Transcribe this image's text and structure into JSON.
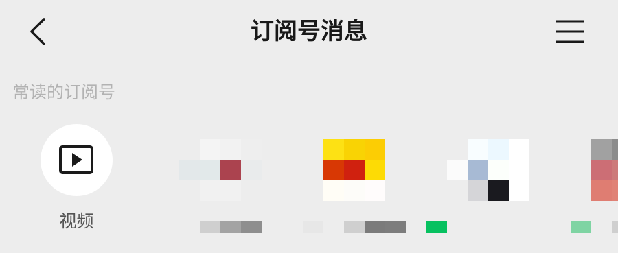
{
  "header": {
    "title": "订阅号消息",
    "back_icon": "chevron-left-icon",
    "menu_icon": "hamburger-menu-icon"
  },
  "frequent": {
    "label": "常读的订阅号",
    "video_account": {
      "name": "视频",
      "icon": "play-icon"
    }
  },
  "colors": {
    "background": "#ededed",
    "title": "#191919",
    "section_label": "#b2b2b2",
    "account_name": "#555555",
    "unread_green": "#07c160"
  }
}
